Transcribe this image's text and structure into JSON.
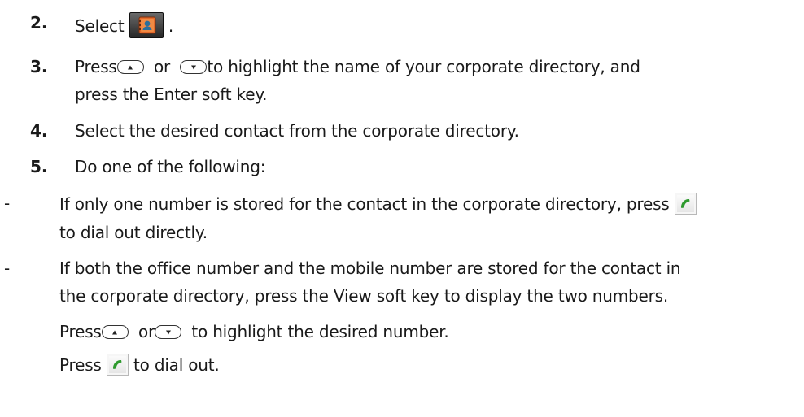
{
  "steps": [
    {
      "number": "2.",
      "before": "Select",
      "after": "."
    },
    {
      "number": "3.",
      "l1_a": "Press",
      "l1_b": "or",
      "l1_c": "to highlight the name of your corporate directory, and",
      "l2": "press the Enter soft key."
    },
    {
      "number": "4.",
      "text": "Select the desired contact from the corporate directory."
    },
    {
      "number": "5.",
      "text": "Do one of the following:"
    }
  ],
  "bullets": [
    {
      "dash": "-",
      "l1_a": "If only one number is stored for the contact in the corporate directory, press",
      "l2": "to dial out directly."
    },
    {
      "dash": "-",
      "l1": "If both the office number and the mobile number are stored for the contact in",
      "l2": "the corporate directory, press the View soft key to display the two numbers."
    }
  ],
  "sub": [
    {
      "a": "Press",
      "b": "or",
      "c": "to highlight the desired number."
    },
    {
      "a": "Press",
      "c": "to dial out."
    }
  ],
  "icons": {
    "directory": "directory-icon",
    "up_key": "up-arrow-key-icon",
    "down_key": "down-arrow-key-icon",
    "call": "call-handset-icon"
  },
  "colors": {
    "text": "#1a1a1a",
    "handset_green": "#2e9a2e",
    "directory_orange": "#e46a2a"
  }
}
